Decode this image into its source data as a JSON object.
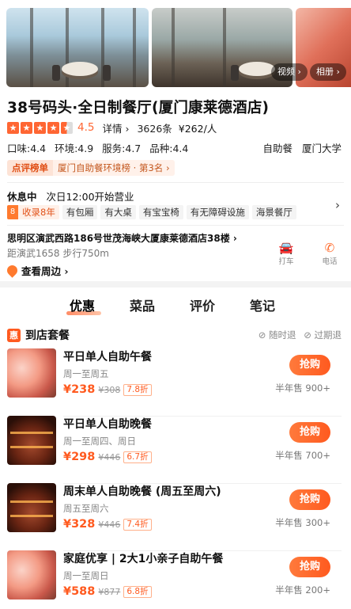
{
  "gallery": {
    "video_label": "视频 ›",
    "album_label": "相册 ›"
  },
  "shop": {
    "title": "38号码头·全日制餐厅(厦门康莱德酒店)",
    "rating_score": "4.5",
    "rating_stars": 4.5,
    "detail_label": "详情 ›",
    "review_count": "3626条",
    "avg_price": "¥262/人",
    "sub_scores": [
      "口味:4.4",
      "环境:4.9",
      "服务:4.7",
      "品种:4.4"
    ],
    "category": "自助餐",
    "area": "厦门大学",
    "rank_tag": "点评榜单",
    "rank_text": "厦门自助餐环境榜 · 第3名 ›"
  },
  "status": {
    "state": "休息中",
    "open_info": "次日12:00开始营业",
    "years_num": "8",
    "years_text": "收录8年",
    "tags": [
      "有包厢",
      "有大桌",
      "有宝宝椅",
      "有无障碍设施",
      "海景餐厅"
    ]
  },
  "location": {
    "address": "思明区演武西路186号世茂海峡大厦康莱德酒店38楼 ›",
    "distance": "距演武1658 步行750m",
    "nearby_label": "查看周边 ›",
    "taxi_label": "打车",
    "phone_label": "电话"
  },
  "tabs": [
    "优惠",
    "菜品",
    "评价",
    "笔记"
  ],
  "section": {
    "icon_label": "惠",
    "title": "到店套餐",
    "refund_any": "⊘ 随时退",
    "refund_expired": "⊘ 过期退"
  },
  "deals": [
    {
      "title": "平日单人自助午餐",
      "days": "周一至周五",
      "price": "¥238",
      "orig": "¥308",
      "discount": "7.8折",
      "buy": "抢购",
      "sold": "半年售 900+"
    },
    {
      "title": "平日单人自助晚餐",
      "days": "周一至周四、周日",
      "price": "¥298",
      "orig": "¥446",
      "discount": "6.7折",
      "buy": "抢购",
      "sold": "半年售 700+"
    },
    {
      "title": "周末单人自助晚餐 (周五至周六)",
      "days": "周五至周六",
      "price": "¥328",
      "orig": "¥446",
      "discount": "7.4折",
      "buy": "抢购",
      "sold": "半年售 300+"
    },
    {
      "title": "家庭优享 | 2大1小亲子自助午餐",
      "days": "周一至周日",
      "price": "¥588",
      "orig": "¥877",
      "discount": "6.8折",
      "buy": "抢购",
      "sold": "半年售 200+"
    }
  ],
  "colors": {
    "accent": "#ff5a1f",
    "rank_bg": "#fde3d6",
    "taxi": "#2c7be5"
  }
}
